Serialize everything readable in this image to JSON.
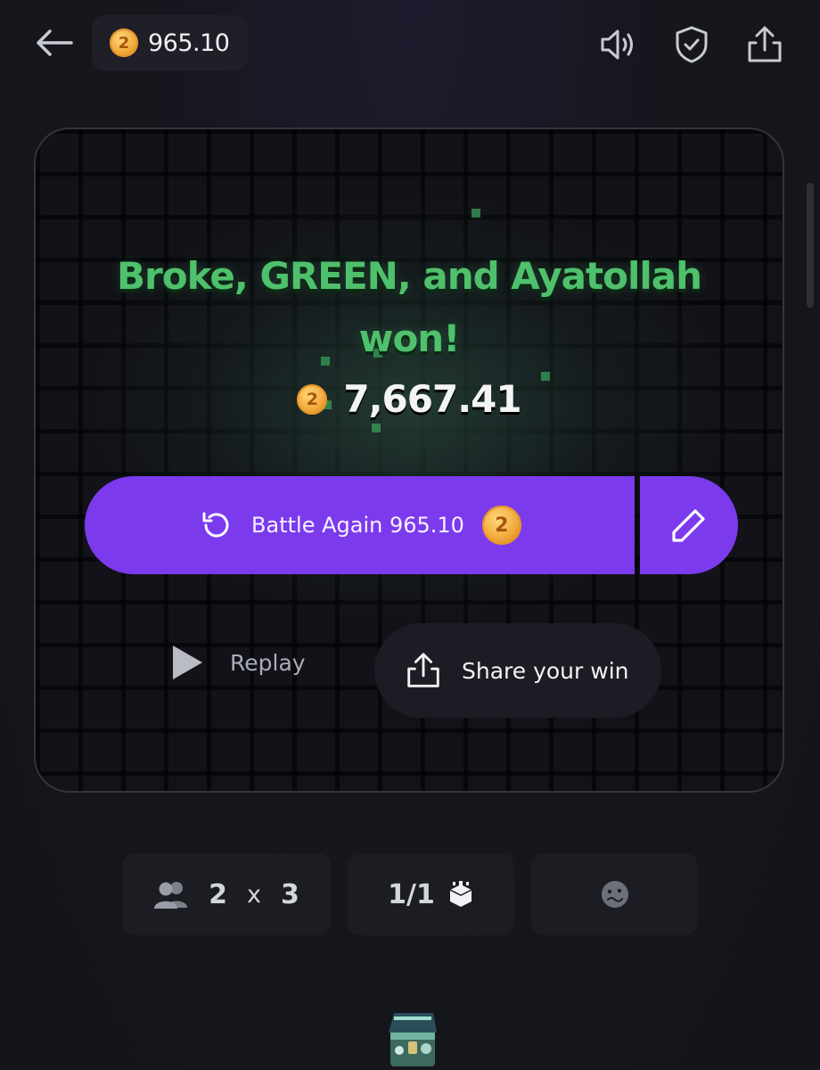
{
  "header": {
    "balance": "965.10",
    "coin_glyph": "2",
    "icons": [
      "back-arrow-icon",
      "sound-icon",
      "shield-check-icon",
      "share-icon"
    ]
  },
  "result": {
    "title_line1": "Broke, GREEN, and Ayatollah",
    "title_line2": "won!",
    "amount": "7,667.41",
    "title_color": "#4fc06b"
  },
  "actions": {
    "battle_again_label": "Battle Again 965.10",
    "replay_label": "Replay",
    "share_label": "Share your win",
    "accent_color": "#7c3aed"
  },
  "stats": {
    "teams": "2",
    "x": "x",
    "players": "3",
    "cases": "1/1"
  }
}
